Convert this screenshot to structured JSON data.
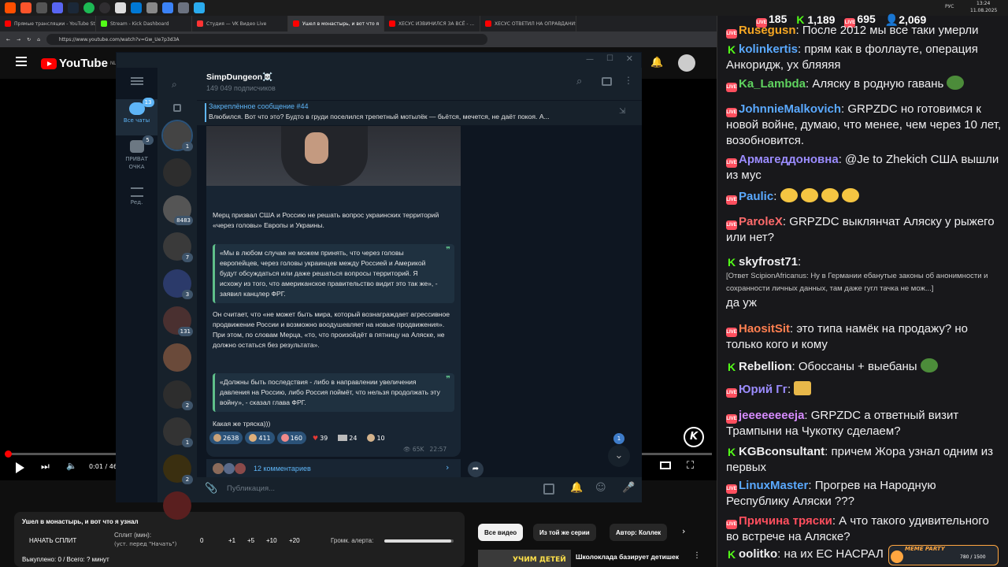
{
  "browser": {
    "tabs": [
      {
        "label": "Прямые трансляции - YouTube Stu",
        "color": "#ff0000"
      },
      {
        "label": "Stream - Kick Dashboard",
        "color": "#53fc18"
      },
      {
        "label": "Студия — VK Видео Live",
        "color": "#ff3333"
      },
      {
        "label": "Ушел в монастырь, и вот что я",
        "color": "#ff0000"
      },
      {
        "label": "ХЕСУС ИЗВИНИЛСЯ ЗА ВСЁ - ...",
        "color": "#ff0000"
      },
      {
        "label": "ХЕСУС ОТВЕТИЛ НА ОПРАВДАНИЯ",
        "color": "#ff0000"
      }
    ],
    "url": "https://www.youtube.com/watch?v=Gw_Ue7p3d3A"
  },
  "youtube": {
    "logo": "YouTube",
    "region": "NL",
    "time": "0:01 / 46",
    "progress": 0.003
  },
  "telegram": {
    "channel_name": "SimpDungeon☠️",
    "subscribers": "149 049 подписчиков",
    "rail": {
      "all_chats_label": "Все чаты",
      "all_chats_count": "13",
      "private_label": "ПРИВАТ ОЧКА",
      "private_count": "5",
      "edit_label": "Ред."
    },
    "chat_list_badges": [
      "1",
      "",
      "8483",
      "7",
      "3",
      "131",
      "",
      "2",
      "1",
      "2",
      ""
    ],
    "pinned_title": "Закреплённое сообщение #44",
    "pinned_text": "Влюбился.   Вот что это? Будто в груди поселился трепетный мотылёк — бьётся, мечется, не даёт покоя. А...",
    "message": {
      "p1": "Мерц призвал США и Россию не решать вопрос украинских территорий «через головы» Европы и Украины.",
      "q1": "«Мы в любом случае не можем принять, что через головы европейцев, через головы украинцев между Россией и Америкой будут обсуждаться или даже решаться вопросы территорий. Я исхожу из того, что американское правительство видит это так же», - заявил канцлер ФРГ.",
      "p2": "Он считает, что «не может быть мира, который вознаграждает агрессивное продвижение России и возможно воодушевляет на новые продвижения». При этом, по словам Мерца, «то, что произойдёт в пятницу на Аляске, не должно остаться без результата».",
      "q2": "«Должны быть последствия - либо в направлении увеличения давления на Россию, либо Россия поймёт, что нельзя продолжать эту войну», - сказал глава ФРГ.",
      "p3": "Какая же тряска)))",
      "reactions": [
        "2638",
        "411",
        "160",
        "39",
        "24",
        "10"
      ],
      "views": "65K",
      "time": "22:57",
      "comments": "12 комментариев"
    },
    "unread_badge": "1",
    "input_placeholder": "Публикация..."
  },
  "split_panel": {
    "title": "Ушел в монастырь, и вот что я узнал",
    "start_button": "НАЧАТЬ СПЛИТ",
    "split_label": "Сплит (мин):",
    "split_hint": "(уст. перед \"Начать\")",
    "split_value": "0",
    "inc_buttons": [
      "+1",
      "+5",
      "+10",
      "+20"
    ],
    "volume_label": "Громк. алерта:",
    "volume": 0.97,
    "bought": "Выкуплено: 0 / Всего: ? минут"
  },
  "yt_chips": [
    "Все видео",
    "Из той же серии",
    "Автор: Коллек"
  ],
  "related": {
    "thumb_text": "УЧИМ ДЕТЕЙ",
    "title": "Школоклада базирует детишек"
  },
  "stream_stats": {
    "yt_viewers": "185",
    "kick_viewers": "1,189",
    "vk_viewers": "695",
    "total_viewers": "2,069"
  },
  "system": {
    "time": "13:24",
    "date": "11.08.2025",
    "lang": "РУС"
  },
  "chat": [
    {
      "platform": "yt",
      "user": "Rusegusn",
      "color": "#f5a623",
      "text": "После 2012 мы все таки умерли"
    },
    {
      "platform": "kick",
      "user": "kolinkertis",
      "color": "#5aa9ff",
      "text": "прям как в фоллауте, операция Анкоридж, ух бляяяя"
    },
    {
      "platform": "yt",
      "user": "Ka_Lambda",
      "color": "#5fd35f",
      "text": "Аляску в родную гавань"
    },
    {
      "platform": "yt",
      "user": "JohnnieMalkovich",
      "color": "#5aa9ff",
      "text": "GRPZDC но готовимся к новой войне, думаю, что менее, чем через 10 лет, возобновится."
    },
    {
      "platform": "yt",
      "user": "Армагеддоновна",
      "color": "#9b8cff",
      "text": "@Je to Zhekich США вышли из мус"
    },
    {
      "platform": "yt",
      "user": "Paulic",
      "color": "#5aa9ff",
      "text": ""
    },
    {
      "platform": "yt",
      "user": "ParoleX",
      "color": "#ff6b6b",
      "text": "GRPZDC выклянчат Аляску у рыжего или нет?"
    },
    {
      "platform": "kick",
      "user": "skyfrost71",
      "color": "#efeff1",
      "reply": "[Ответ ScipionAfricanus: Ну в Германии ебанутые законы об анонимности и сохранности личных данных, там даже гугл тачка не мож...]",
      "text": "да уж"
    },
    {
      "platform": "yt",
      "user": "HaositSit",
      "color": "#ff7f50",
      "text": "это типа намёк на продажу? но только кого и кому"
    },
    {
      "platform": "kick",
      "user": "Rebellion",
      "color": "#efeff1",
      "text": "Обоссаны + выебаны"
    },
    {
      "platform": "yt",
      "user": "Юрий Гг",
      "color": "#9b8cff",
      "text": ""
    },
    {
      "platform": "yt",
      "user": "jeeeeeeeeja",
      "color": "#d78cff",
      "text": "GRPZDC а ответный визит Трампыни на Чукотку сделаем?"
    },
    {
      "platform": "kick",
      "user": "KGBconsultant",
      "color": "#efeff1",
      "text": "причем Жора узнал одним из первых"
    },
    {
      "platform": "yt",
      "user": "LinuxMaster",
      "color": "#5aa9ff",
      "text": "Прогрев на Народную Республику Аляски ???"
    },
    {
      "platform": "yt",
      "user": "Причина тряски",
      "color": "#ff4f5e",
      "text": "А что такого удивительного во встрече на Аляске?"
    },
    {
      "platform": "kick",
      "user": "oolitko",
      "color": "#efeff1",
      "text": "на их ЕС НАСРАЛ"
    }
  ],
  "meme_badge": {
    "label": "MEME PARTY",
    "progress": "780 / 1500"
  }
}
